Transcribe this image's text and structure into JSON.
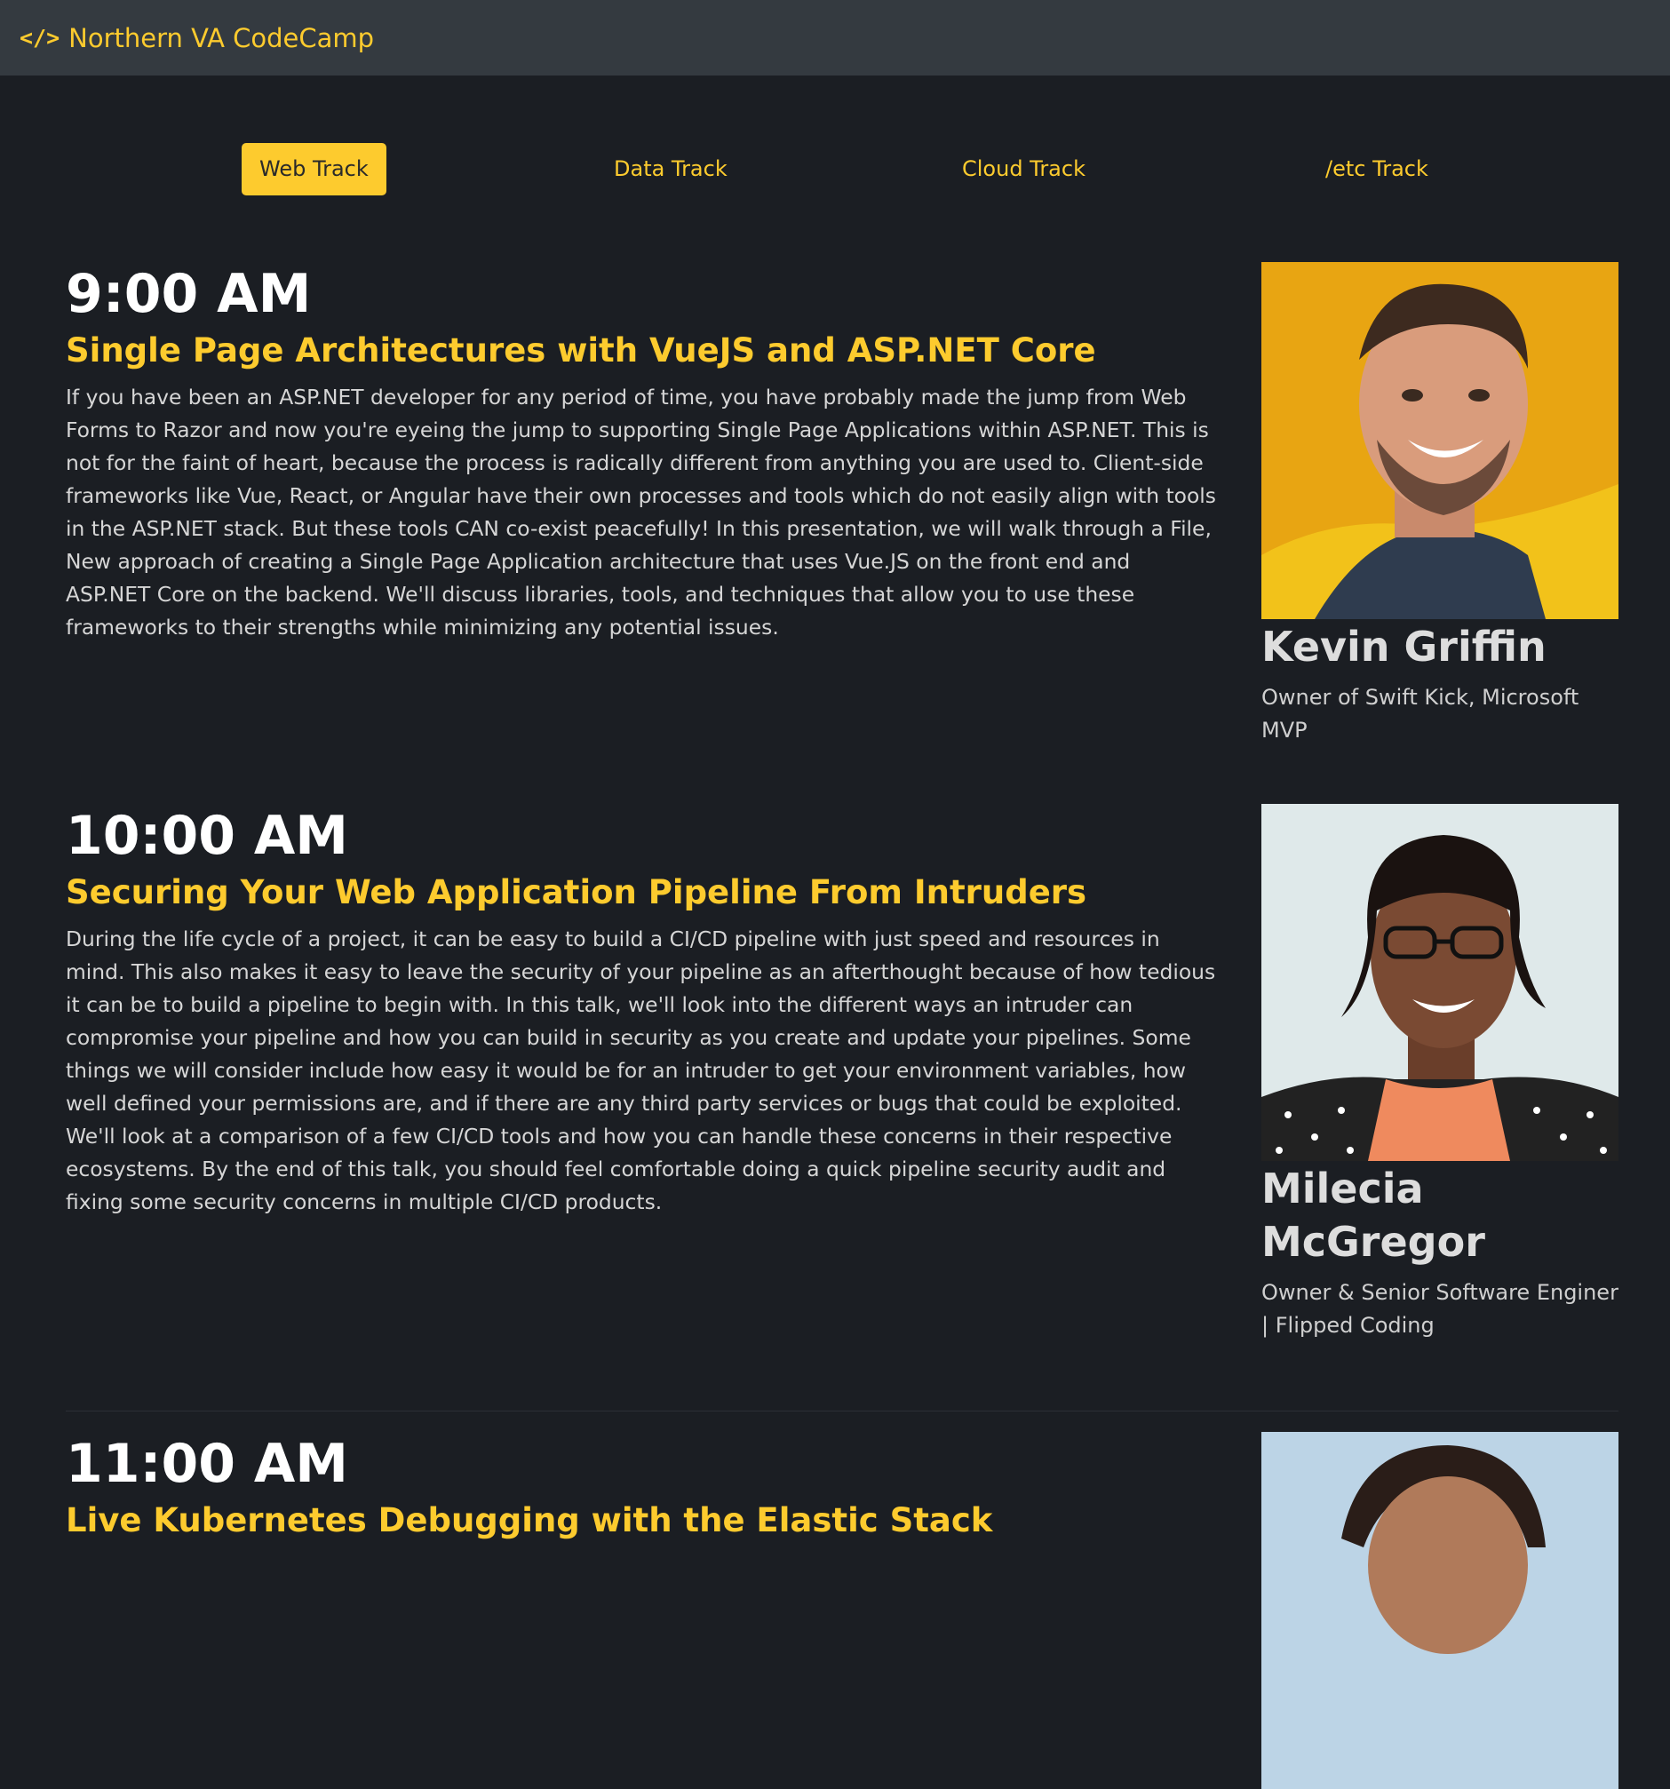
{
  "nav": {
    "icon": "code-icon",
    "icon_glyph": "</>",
    "brand": "Northern VA CodeCamp"
  },
  "tracks": [
    {
      "label": "Web Track",
      "active": true
    },
    {
      "label": "Data Track",
      "active": false
    },
    {
      "label": "Cloud Track",
      "active": false
    },
    {
      "label": "/etc Track",
      "active": false
    }
  ],
  "sessions": [
    {
      "time": "9:00 AM",
      "title": "Single Page Architectures with VueJS and ASP.NET Core",
      "description": "If you have been an ASP.NET developer for any period of time, you have probably made the jump from Web Forms to Razor and now you're eyeing the jump to supporting Single Page Applications within ASP.NET. This is not for the faint of heart, because the process is radically different from anything you are used to. Client-side frameworks like Vue, React, or Angular have their own processes and tools which do not easily align with tools in the ASP.NET stack. But these tools CAN co-exist peacefully! In this presentation, we will walk through a File, New approach of creating a Single Page Application architecture that uses Vue.JS on the front end and ASP.NET Core on the backend. We'll discuss libraries, tools, and techniques that allow you to use these frameworks to their strengths while minimizing any potential issues.",
      "speaker": {
        "name": "Kevin Griffin",
        "title": "Owner of Swift Kick, Microsoft MVP"
      }
    },
    {
      "time": "10:00 AM",
      "title": "Securing Your Web Application Pipeline From Intruders",
      "description": "During the life cycle of a project, it can be easy to build a CI/CD pipeline with just speed and resources in mind. This also makes it easy to leave the security of your pipeline as an afterthought because of how tedious it can be to build a pipeline to begin with. In this talk, we'll look into the different ways an intruder can compromise your pipeline and how you can build in security as you create and update your pipelines. Some things we will consider include how easy it would be for an intruder to get your environment variables, how well defined your permissions are, and if there are any third party services or bugs that could be exploited. We'll look at a comparison of a few CI/CD tools and how you can handle these concerns in their respective ecosystems. By the end of this talk, you should feel comfortable doing a quick pipeline security audit and fixing some security concerns in multiple CI/CD products.",
      "speaker": {
        "name": "Milecia McGregor",
        "title": "Owner & Senior Software Enginer | Flipped Coding"
      }
    },
    {
      "time": "11:00 AM",
      "title": "Live Kubernetes Debugging with the Elastic Stack"
    }
  ],
  "colors": {
    "accent": "#fdcb2e",
    "navbar": "#343a40",
    "background": "#1b1e23"
  }
}
